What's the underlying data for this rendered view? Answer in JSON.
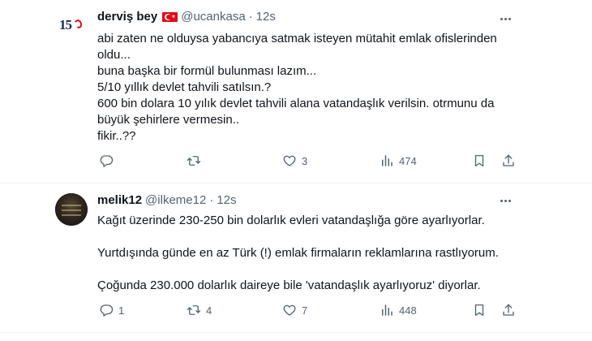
{
  "tweets": [
    {
      "avatar_text": "15",
      "name": "derviş bey",
      "handle": "@ucankasa",
      "time": "12s",
      "lines": [
        "abi zaten ne olduysa yabancıya satmak isteyen mütahit emlak ofislerinden",
        "oldu...",
        "buna başka bir formül bulunması lazım...",
        "5/10 yıllık  devlet tahvili satılsın.?",
        "600 bin dolara 10 yılık devlet tahvili alana vatandaşlık verilsin. otrmunu da",
        "büyük şehirlere vermesin..",
        "fikir..??"
      ],
      "replies": "",
      "retweets": "",
      "likes": "3",
      "views": "474"
    },
    {
      "name": "melik12",
      "handle": "@ilkeme12",
      "time": "12s",
      "paragraphs": [
        "Kağıt üzerinde 230-250 bin dolarlık evleri vatandaşlığa göre ayarlıyorlar.",
        "Yurtdışında günde en az Türk (!) emlak firmaların reklamlarına rastlıyorum.",
        "Çoğunda 230.000 dolarlık daireye bile 'vatandaşlık ayarlıyoruz' diyorlar."
      ],
      "replies": "1",
      "retweets": "4",
      "likes": "7",
      "views": "448"
    }
  ],
  "colors": {
    "text": "#0f1419",
    "secondary": "#536471",
    "divider": "#eff3f4",
    "flag": "#e30a17"
  },
  "icons": [
    "more-icon",
    "reply-icon",
    "retweet-icon",
    "like-icon",
    "views-icon",
    "bookmark-icon",
    "share-icon",
    "turkey-flag-icon"
  ]
}
